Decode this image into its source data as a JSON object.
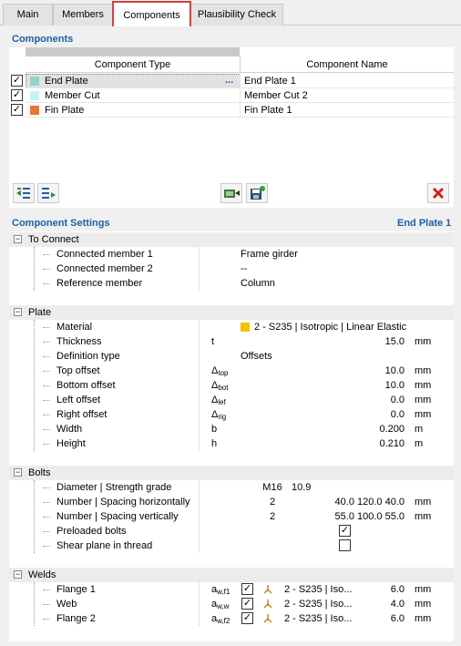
{
  "tabs": [
    "Main",
    "Members",
    "Components",
    "Plausibility Check"
  ],
  "components": {
    "title": "Components",
    "col_type": "Component Type",
    "col_name": "Component Name",
    "rows": [
      {
        "type": "End Plate",
        "name": "End Plate 1",
        "color": "#8fd3c9",
        "checked": "✓"
      },
      {
        "type": "Member Cut",
        "name": "Member Cut 2",
        "color": "#c9f2f7",
        "checked": "✓"
      },
      {
        "type": "Fin Plate",
        "name": "Fin Plate 1",
        "color": "#e8762b",
        "checked": "✓"
      }
    ],
    "ellipsis": "..."
  },
  "settings": {
    "title": "Component Settings",
    "current": "End Plate 1",
    "to_connect": {
      "label": "To Connect",
      "rows": [
        {
          "label": "Connected member 1",
          "value": "Frame girder"
        },
        {
          "label": "Connected member 2",
          "value": "--"
        },
        {
          "label": "Reference member",
          "value": "Column"
        }
      ]
    },
    "plate": {
      "label": "Plate",
      "material": {
        "label": "Material",
        "value": "2 - S235 | Isotropic | Linear Elastic",
        "color": "#f2c200"
      },
      "thickness": {
        "label": "Thickness",
        "symbol": "t",
        "value": "15.0",
        "unit": "mm"
      },
      "definition": {
        "label": "Definition type",
        "value": "Offsets"
      },
      "top": {
        "label": "Top offset",
        "sym": "Δ",
        "sub": "top",
        "value": "10.0",
        "unit": "mm"
      },
      "bottom": {
        "label": "Bottom offset",
        "sym": "Δ",
        "sub": "bot",
        "value": "10.0",
        "unit": "mm"
      },
      "left": {
        "label": "Left offset",
        "sym": "Δ",
        "sub": "lef",
        "value": "0.0",
        "unit": "mm"
      },
      "right": {
        "label": "Right offset",
        "sym": "Δ",
        "sub": "rig",
        "value": "0.0",
        "unit": "mm"
      },
      "width": {
        "label": "Width",
        "symbol": "b",
        "value": "0.200",
        "unit": "m"
      },
      "height": {
        "label": "Height",
        "symbol": "h",
        "value": "0.210",
        "unit": "m"
      }
    },
    "bolts": {
      "label": "Bolts",
      "diameter": {
        "label": "Diameter | Strength grade",
        "v1": "M16",
        "v2": "10.9"
      },
      "horiz": {
        "label": "Number | Spacing horizontally",
        "n": "2",
        "v": "40.0 120.0 40.0",
        "unit": "mm"
      },
      "vert": {
        "label": "Number | Spacing vertically",
        "n": "2",
        "v": "55.0 100.0 55.0",
        "unit": "mm"
      },
      "preloaded": {
        "label": "Preloaded bolts",
        "mark": "✓"
      },
      "shear": {
        "label": "Shear plane in thread",
        "mark": ""
      }
    },
    "welds": {
      "label": "Welds",
      "rows": [
        {
          "label": "Flange 1",
          "sym": "a",
          "sub": "w,f1",
          "mark": "✓",
          "mat": "2 - S235 | Iso...",
          "value": "6.0",
          "unit": "mm"
        },
        {
          "label": "Web",
          "sym": "a",
          "sub": "w,w",
          "mark": "✓",
          "mat": "2 - S235 | Iso...",
          "value": "4.0",
          "unit": "mm"
        },
        {
          "label": "Flange 2",
          "sym": "a",
          "sub": "w,f2",
          "mark": "✓",
          "mat": "2 - S235 | Iso...",
          "value": "6.0",
          "unit": "mm"
        }
      ]
    }
  },
  "icons": [
    "select-all-icon",
    "deselect-icon",
    "library-icon",
    "save-icon",
    "delete-icon"
  ]
}
